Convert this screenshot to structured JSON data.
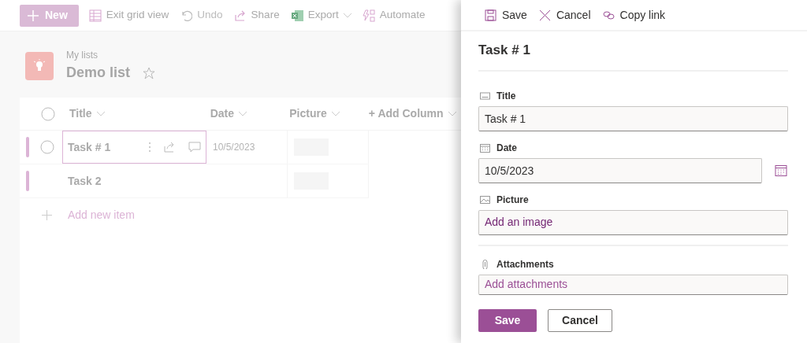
{
  "toolbar": [
    {
      "label": "New",
      "kind": "new",
      "disabled": false
    },
    {
      "label": "Exit grid view",
      "kind": "grid",
      "disabled": false
    },
    {
      "label": "Undo",
      "kind": "undo",
      "disabled": true
    },
    {
      "label": "Share",
      "kind": "share",
      "disabled": false
    },
    {
      "label": "Export",
      "kind": "export",
      "disabled": false
    },
    {
      "label": "Automate",
      "kind": "automate",
      "disabled": false
    }
  ],
  "list": {
    "breadcrumb": "My lists",
    "title": "Demo list",
    "favorite": false
  },
  "grid": {
    "columns": [
      "Title",
      "Date",
      "Picture",
      "+ Add Column"
    ],
    "rows": [
      {
        "title": "Task # 1",
        "date": "10/5/2023",
        "hovered": true,
        "focused": true
      },
      {
        "title": "Task 2",
        "hovered": false,
        "focused": false
      }
    ],
    "add_item": "Add new item"
  },
  "panel": {
    "toolbar": [
      {
        "label": "Save",
        "kind": "save"
      },
      {
        "label": "Cancel",
        "kind": "cancel"
      },
      {
        "label": "Copy link",
        "kind": "link"
      }
    ],
    "title": "Task # 1",
    "fields": [
      {
        "kind": "text",
        "label": "Title",
        "value": "Task # 1"
      },
      {
        "kind": "date",
        "label": "Date",
        "value": "10/5/2023"
      },
      {
        "kind": "image",
        "label": "Picture",
        "action": "Add an image"
      },
      {
        "kind": "attachments",
        "label": "Attachments",
        "action": "Add attachments"
      }
    ],
    "buttons": [
      {
        "label": "Save",
        "kind": "primary"
      },
      {
        "label": "Cancel",
        "kind": "default"
      }
    ]
  }
}
